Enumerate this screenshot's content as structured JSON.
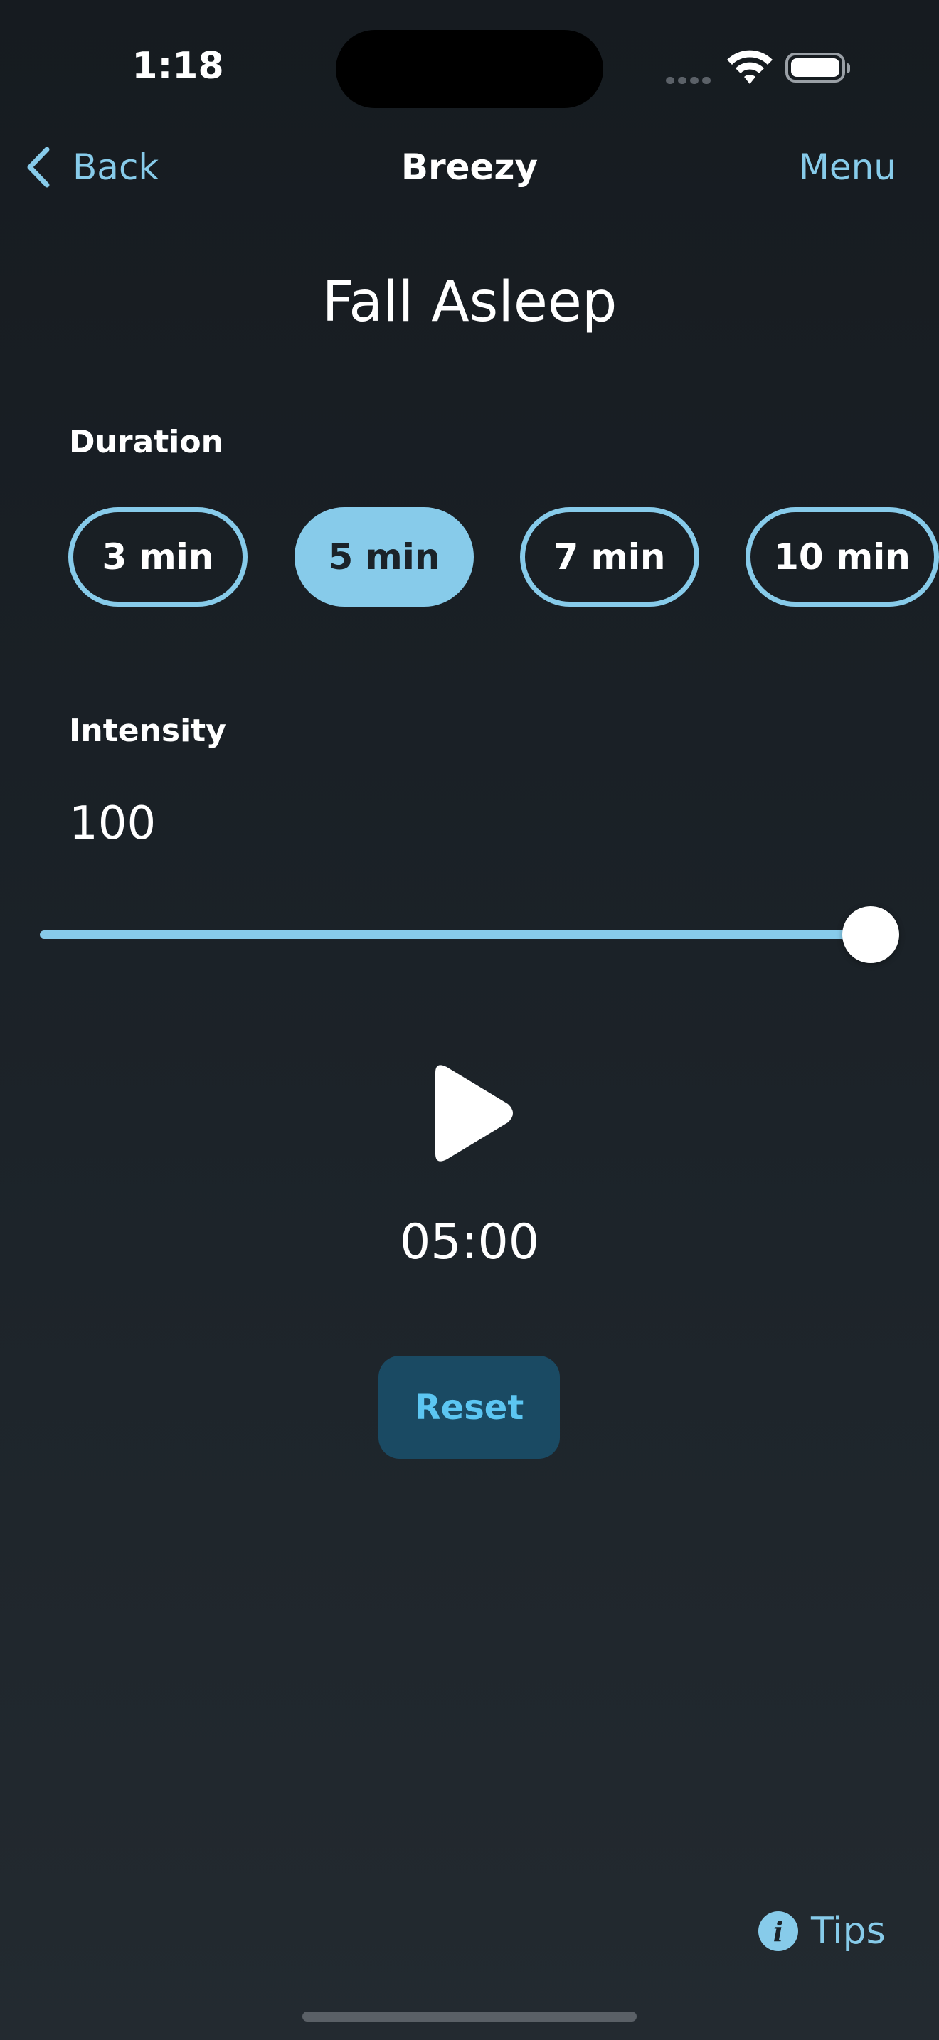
{
  "status_bar": {
    "time": "1:18"
  },
  "nav": {
    "back_label": "Back",
    "title": "Breezy",
    "menu_label": "Menu"
  },
  "page": {
    "title": "Fall Asleep"
  },
  "duration": {
    "label": "Duration",
    "options": [
      "3 min",
      "5 min",
      "7 min",
      "10 min"
    ],
    "selected": "5 min"
  },
  "intensity": {
    "label": "Intensity",
    "value": "100",
    "slider_fraction": 1.0
  },
  "player": {
    "timer": "05:00",
    "reset_label": "Reset"
  },
  "footer": {
    "tips_label": "Tips"
  },
  "colors": {
    "accent": "#87cbea",
    "reset_bg": "#1a4a63",
    "reset_text": "#5cc6f2",
    "background": "#1c2329"
  },
  "icons": {
    "back": "chevron-left-icon",
    "play": "play-icon",
    "tips": "info-icon",
    "wifi": "wifi-icon",
    "battery": "battery-icon"
  }
}
